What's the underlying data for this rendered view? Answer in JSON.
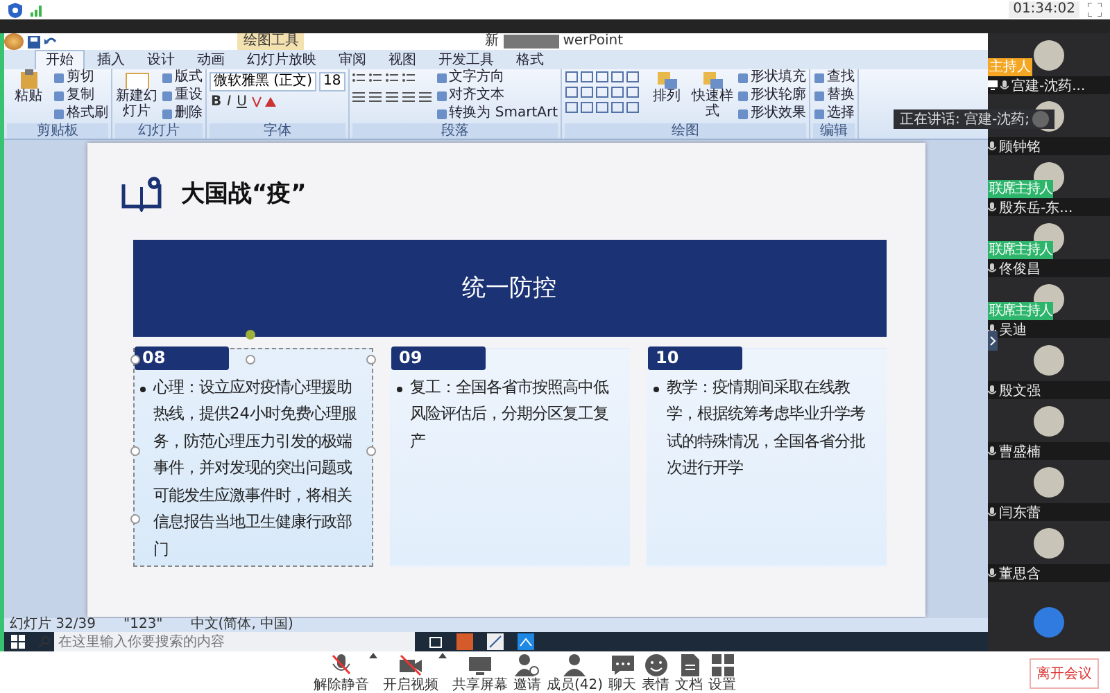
{
  "top_bar": {
    "clock": "01:34:02"
  },
  "app": {
    "context_tab": "绘图工具",
    "title_parts": [
      "新",
      "werPoint"
    ],
    "tabs": [
      {
        "label": "开始",
        "selected": true
      },
      {
        "label": "插入",
        "selected": false
      },
      {
        "label": "设计",
        "selected": false
      },
      {
        "label": "动画",
        "selected": false
      },
      {
        "label": "幻灯片放映",
        "selected": false
      },
      {
        "label": "审阅",
        "selected": false
      },
      {
        "label": "视图",
        "selected": false
      },
      {
        "label": "开发工具",
        "selected": false
      },
      {
        "label": "格式",
        "selected": false
      }
    ],
    "ribbon": [
      {
        "kind": "clipboard",
        "label": "剪贴板",
        "big": [
          "粘贴"
        ],
        "small": [
          "剪切",
          "复制",
          "格式刷"
        ]
      },
      {
        "kind": "slides",
        "label": "幻灯片",
        "big": [
          "新建幻灯片"
        ],
        "small": [
          "版式",
          "重设",
          "删除"
        ]
      },
      {
        "kind": "font",
        "label": "字体",
        "font": "微软雅黑 (正文)",
        "size": "18",
        "format_buttons": [
          "B",
          "I",
          "U"
        ]
      },
      {
        "kind": "paragraph",
        "label": "段落",
        "small": [
          "文字方向",
          "对齐文本",
          "转换为 SmartArt"
        ]
      },
      {
        "kind": "drawing",
        "label": "绘图",
        "big": [
          "排列",
          "快速样式"
        ],
        "small": [
          "形状填充",
          "形状轮廓",
          "形状效果"
        ]
      },
      {
        "kind": "editing",
        "label": "编辑",
        "small": [
          "查找",
          "替换",
          "选择"
        ]
      }
    ],
    "slide": {
      "title": "大国战“疫”",
      "banner": "统一防控",
      "cards": [
        {
          "number": "08",
          "text": "心理：设立应对疫情心理援助热线，提供24小时免费心理服务，防范心理压力引发的极端事件，并对发现的突出问题或可能发生应激事件时，将相关信息报告当地卫生健康行政部门",
          "selected": true
        },
        {
          "number": "09",
          "text": "复工：全国各省市按照高中低风险评估后，分期分区复工复产",
          "selected": false
        },
        {
          "number": "10",
          "text": "教学：疫情期间采取在线教学，根据统筹考虑毕业升学考试的特殊情况，全国各省分批次进行开学",
          "selected": false
        }
      ]
    },
    "status_bar": [
      "幻灯片 32/39",
      "\"123\"",
      "中文(简体, 中国)"
    ]
  },
  "taskbar": {
    "search": {
      "placeholder": "在这里输入你要搜索的内容"
    }
  },
  "participants": {
    "speaking": "正在讲话: 宫建-沈药;",
    "items": [
      {
        "kind": "host",
        "badge": "主持人",
        "name": "宫建-沈药..."
      },
      {
        "kind": "member",
        "name": "顾钟铭"
      },
      {
        "kind": "cohost",
        "badge": "联席主持人",
        "name": "殷东岳-东..."
      },
      {
        "kind": "cohost",
        "badge": "联席主持人",
        "name": "佟俊昌"
      },
      {
        "kind": "cohost",
        "badge": "联席主持人",
        "name": "吴迪"
      },
      {
        "kind": "member",
        "name": "殷文强"
      },
      {
        "kind": "member",
        "name": "曹盛楠"
      },
      {
        "kind": "member",
        "name": "闫东蕾"
      },
      {
        "kind": "member",
        "name": "董思含"
      }
    ]
  },
  "toolbar": {
    "items": [
      {
        "kind": "mic",
        "label": "解除静音",
        "caret": true
      },
      {
        "kind": "video",
        "label": "开启视频",
        "caret": true
      },
      {
        "kind": "share",
        "label": "共享屏幕",
        "caret": false
      },
      {
        "kind": "invite",
        "label": "邀请",
        "caret": false
      },
      {
        "kind": "members",
        "label": "成员(42)",
        "caret": false
      },
      {
        "kind": "chat",
        "label": "聊天",
        "caret": false
      },
      {
        "kind": "emoji",
        "label": "表情",
        "caret": false
      },
      {
        "kind": "doc",
        "label": "文档",
        "caret": false
      },
      {
        "kind": "settings",
        "label": "设置",
        "caret": false
      }
    ],
    "leave": "离开会议"
  }
}
